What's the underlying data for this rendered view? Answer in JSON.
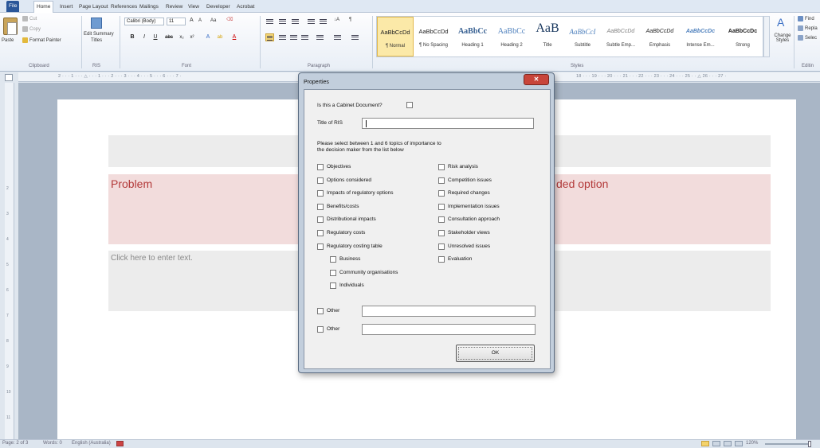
{
  "ribbon_tabs": [
    "File",
    "Home",
    "Insert",
    "Page Layout",
    "References",
    "Mailings",
    "Review",
    "View",
    "Developer",
    "Acrobat"
  ],
  "clipboard": {
    "paste": "Paste",
    "cut": "Cut",
    "copy": "Copy",
    "format_painter": "Format Painter",
    "group": "Clipboard"
  },
  "ris": {
    "edit_summary": "Edit Summary",
    "titles": "Titles",
    "group": "RIS"
  },
  "font": {
    "name": "Calibri (Body)",
    "size": "11",
    "group": "Font"
  },
  "paragraph": {
    "group": "Paragraph"
  },
  "styles": {
    "group": "Styles",
    "items": [
      {
        "sample": "AaBbCcDd",
        "name": "¶ Normal"
      },
      {
        "sample": "AaBbCcDd",
        "name": "¶ No Spacing"
      },
      {
        "sample": "AaBbCc",
        "name": "Heading 1"
      },
      {
        "sample": "AaBbCc",
        "name": "Heading 2"
      },
      {
        "sample": "AaB",
        "name": "Title"
      },
      {
        "sample": "AaBbCcI",
        "name": "Subtitle"
      },
      {
        "sample": "AaBbCcDd",
        "name": "Subtle Emp..."
      },
      {
        "sample": "AaBbCcDd",
        "name": "Emphasis"
      },
      {
        "sample": "AaBbCcDc",
        "name": "Intense Em..."
      },
      {
        "sample": "AaBbCcDc",
        "name": "Strong"
      }
    ],
    "change_styles": "Change Styles"
  },
  "editing": {
    "find": "Find",
    "replace": "Repla",
    "select": "Selec",
    "group": "Editin"
  },
  "document": {
    "problem_heading": "Problem",
    "option_heading": "ded option",
    "placeholder": "Click here to enter text."
  },
  "dialog": {
    "title": "Properties",
    "close": "✕",
    "cabinet_question": "Is this a Cabinet Document?",
    "title_of_ris_label": "Title of RIS",
    "title_of_ris_value": "",
    "instructions_line1": "Please select between 1 and 6 topics of importance to",
    "instructions_line2": "the decision maker from the list below",
    "left_topics": [
      "Objectives",
      "Options considered",
      "Impacts of regulatory options",
      "Benefits/costs",
      "Distributional impacts",
      "Regulatory costs",
      "Regulatory costing table"
    ],
    "sub_topics": [
      "Business",
      "Community organisations",
      "Individuals"
    ],
    "right_topics": [
      "Risk analysis",
      "Competition issues",
      "Required changes",
      "Implementation issues",
      "Consultation approach",
      "Stakeholder views",
      "Unresolved issues",
      "Evaluation"
    ],
    "other1": "Other",
    "other2": "Other",
    "ok": "OK"
  },
  "status": {
    "page": "Page: 2 of 3",
    "words": "Words: 0",
    "language": "English (Australia)",
    "zoom": "120%"
  }
}
